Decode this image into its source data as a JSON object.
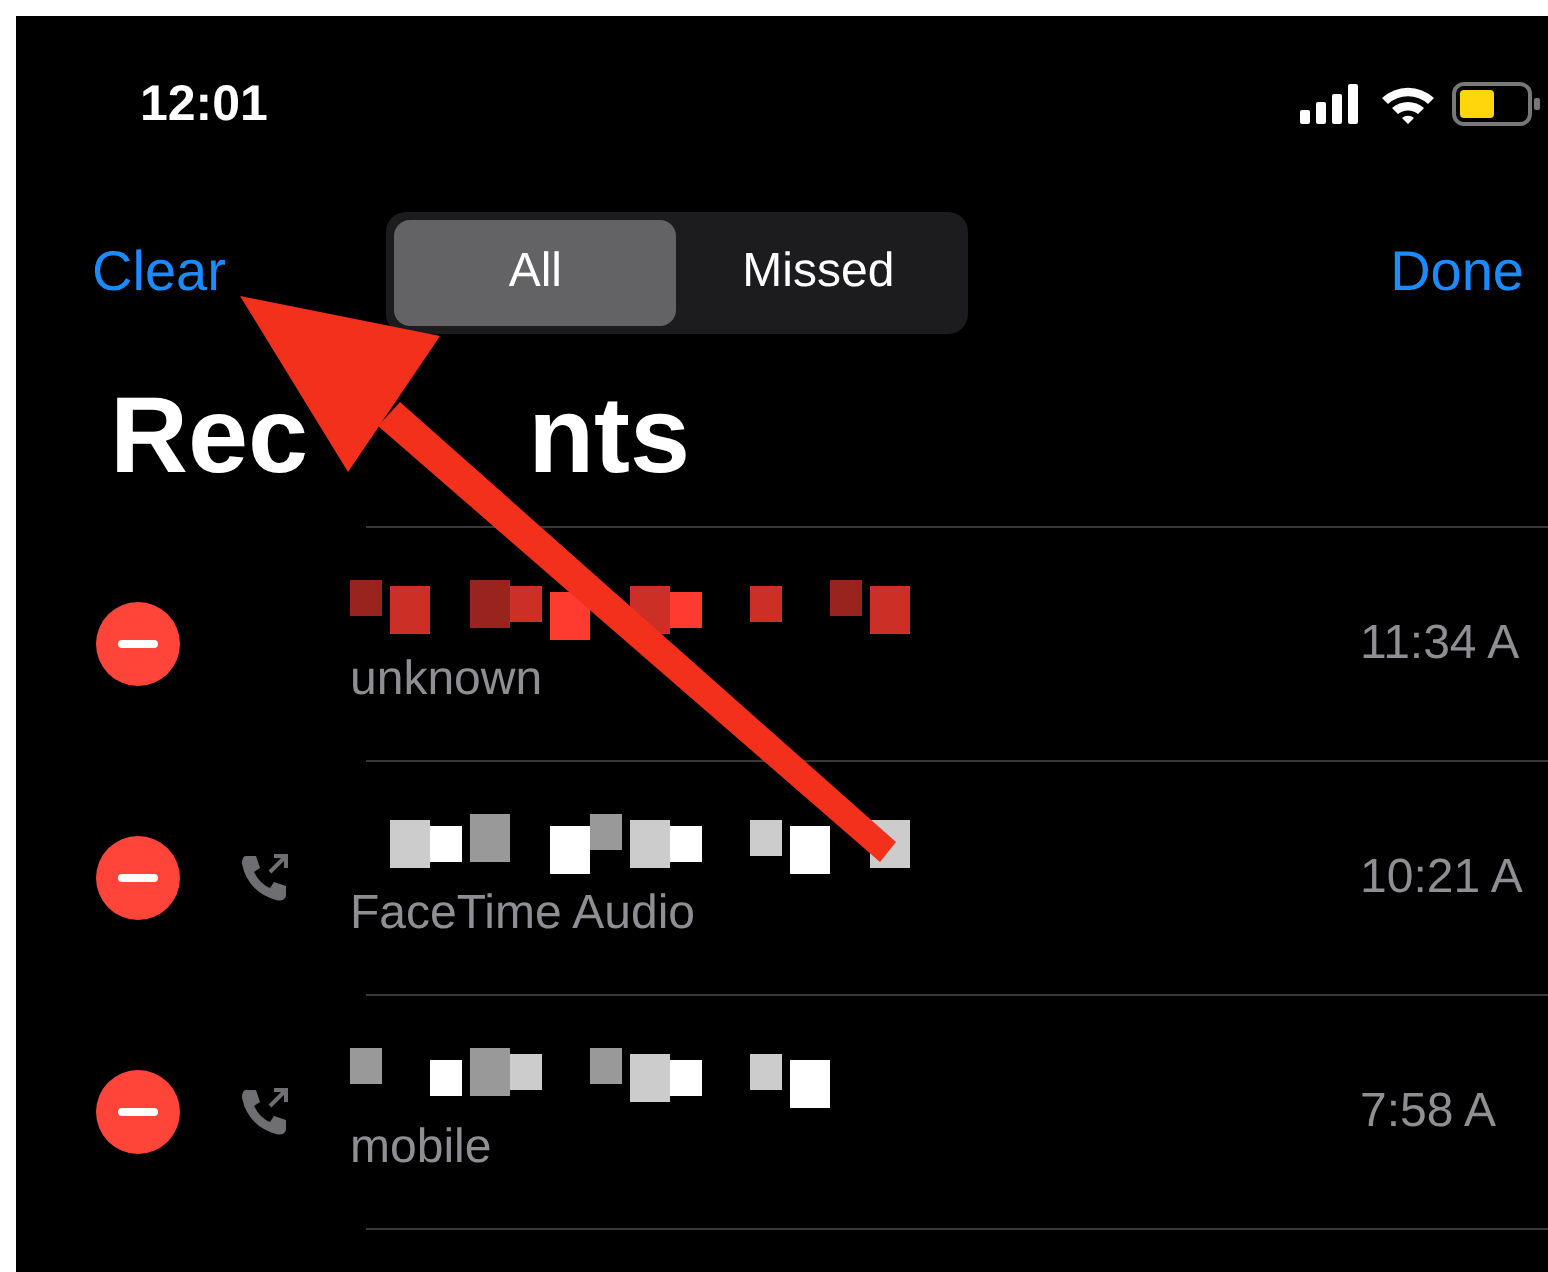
{
  "status_bar": {
    "time": "12:01"
  },
  "nav": {
    "left": "Clear",
    "right": "Done",
    "segments": [
      {
        "label": "All",
        "selected": true
      },
      {
        "label": "Missed",
        "selected": false
      }
    ]
  },
  "title": [
    "Rec",
    "nts"
  ],
  "calls": [
    {
      "missed": true,
      "outgoing": false,
      "detail": "unknown",
      "time": "11:34 A"
    },
    {
      "missed": false,
      "outgoing": true,
      "detail": "FaceTime Audio",
      "time": "10:21 A"
    },
    {
      "missed": false,
      "outgoing": true,
      "detail": "mobile",
      "time": "7:58 A"
    }
  ],
  "annotation": {
    "kind": "arrow"
  }
}
